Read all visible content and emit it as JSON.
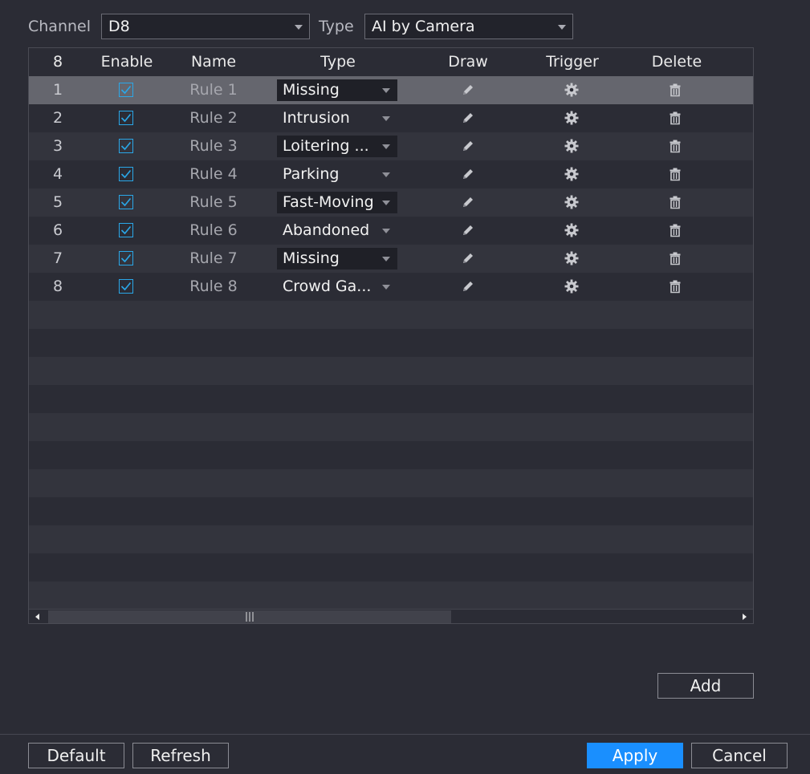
{
  "filters": {
    "channel_label": "Channel",
    "channel_value": "D8",
    "type_label": "Type",
    "type_value": "AI by Camera"
  },
  "table": {
    "headers": {
      "index": "8",
      "enable": "Enable",
      "name": "Name",
      "type": "Type",
      "draw": "Draw",
      "trigger": "Trigger",
      "delete": "Delete"
    },
    "rows": [
      {
        "index": "1",
        "enabled": true,
        "name": "Rule 1",
        "type": "Missing",
        "selected": true
      },
      {
        "index": "2",
        "enabled": true,
        "name": "Rule 2",
        "type": "Intrusion",
        "selected": false
      },
      {
        "index": "3",
        "enabled": true,
        "name": "Rule 3",
        "type": "Loitering ...",
        "selected": false
      },
      {
        "index": "4",
        "enabled": true,
        "name": "Rule 4",
        "type": "Parking",
        "selected": false
      },
      {
        "index": "5",
        "enabled": true,
        "name": "Rule 5",
        "type": "Fast-Moving",
        "selected": false
      },
      {
        "index": "6",
        "enabled": true,
        "name": "Rule 6",
        "type": "Abandoned",
        "selected": false
      },
      {
        "index": "7",
        "enabled": true,
        "name": "Rule 7",
        "type": "Missing",
        "selected": false
      },
      {
        "index": "8",
        "enabled": true,
        "name": "Rule 8",
        "type": "Crowd Ga...",
        "selected": false
      }
    ]
  },
  "buttons": {
    "add": "Add",
    "default": "Default",
    "refresh": "Refresh",
    "apply": "Apply",
    "cancel": "Cancel"
  },
  "colors": {
    "accent": "#1a8ffe",
    "checkbox": "#2aa7e8",
    "background": "#2b2c35"
  },
  "icons": {
    "draw": "pencil-icon",
    "trigger": "gear-icon",
    "delete": "trash-icon"
  }
}
